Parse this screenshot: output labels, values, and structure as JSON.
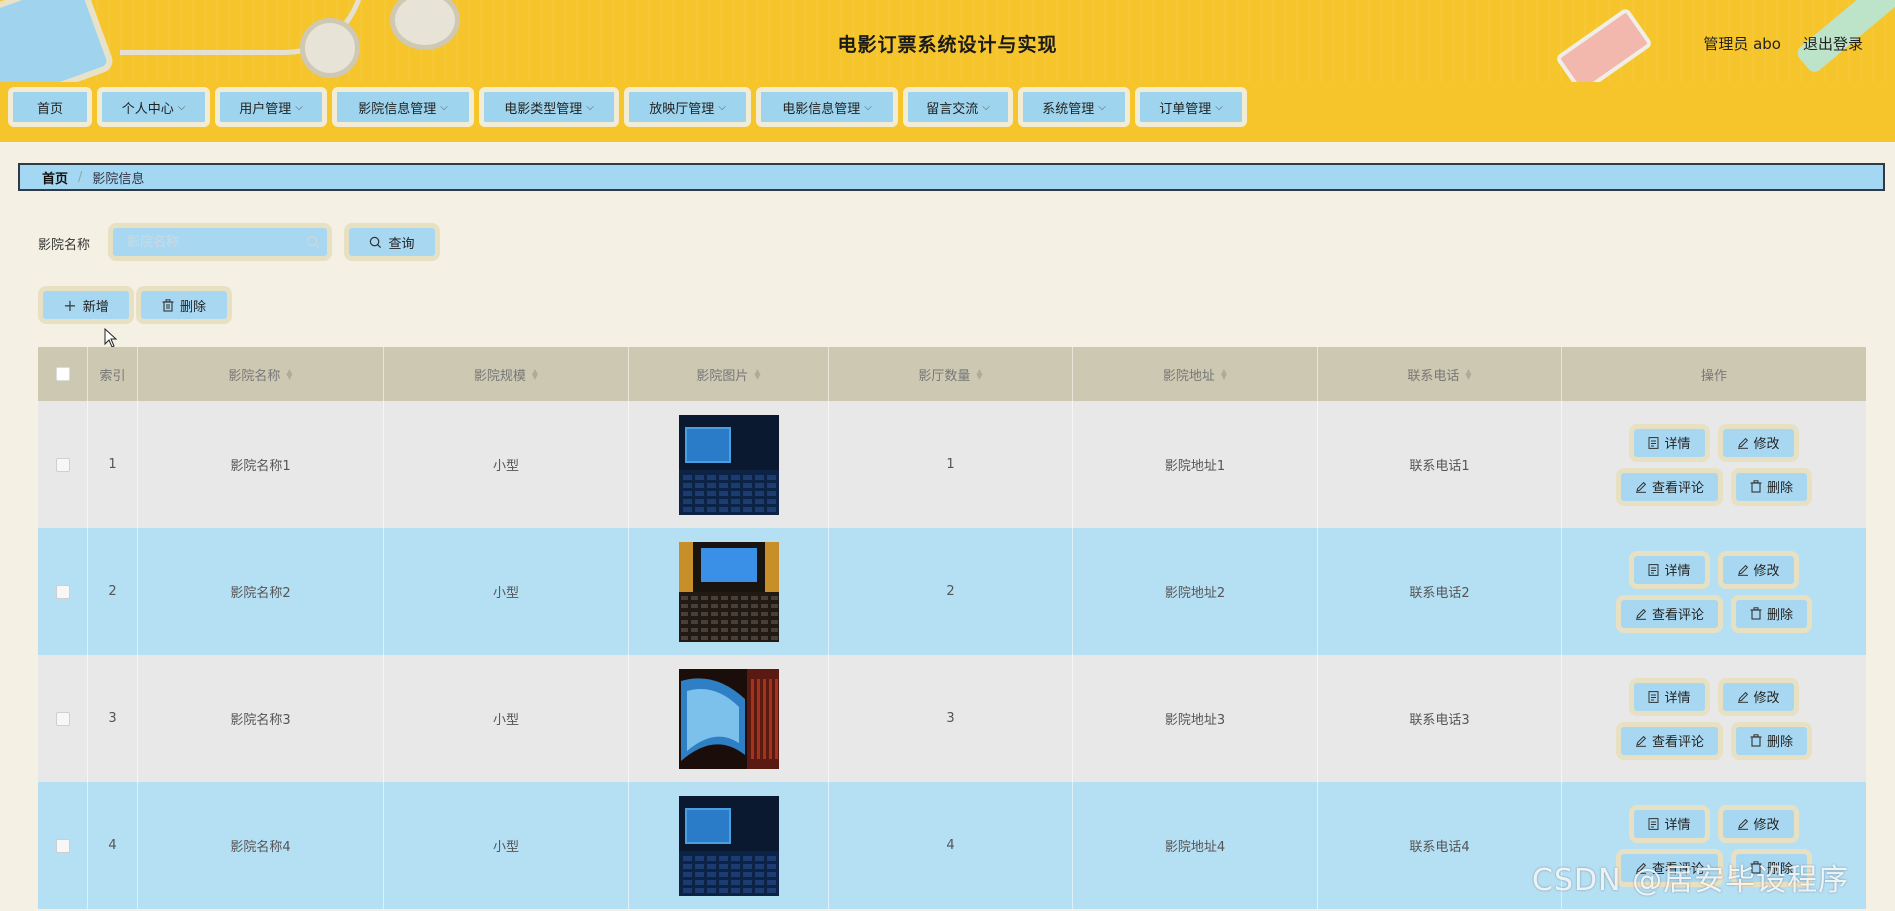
{
  "header": {
    "title": "电影订票系统设计与实现",
    "user": "管理员 abo",
    "logout": "退出登录",
    "background_color": "#f6c52c"
  },
  "nav": {
    "items": [
      {
        "label": "首页",
        "dropdown": false
      },
      {
        "label": "个人中心",
        "dropdown": true
      },
      {
        "label": "用户管理",
        "dropdown": true
      },
      {
        "label": "影院信息管理",
        "dropdown": true
      },
      {
        "label": "电影类型管理",
        "dropdown": true
      },
      {
        "label": "放映厅管理",
        "dropdown": true
      },
      {
        "label": "电影信息管理",
        "dropdown": true
      },
      {
        "label": "留言交流",
        "dropdown": true
      },
      {
        "label": "系统管理",
        "dropdown": true
      },
      {
        "label": "订单管理",
        "dropdown": true
      }
    ]
  },
  "breadcrumb": {
    "home": "首页",
    "separator": "/",
    "current": "影院信息"
  },
  "search": {
    "label": "影院名称",
    "placeholder": "影院名称",
    "value": "",
    "button": "查询"
  },
  "actions": {
    "add": "新增",
    "delete": "删除"
  },
  "table": {
    "columns": [
      "索引",
      "影院名称",
      "影院规模",
      "影院图片",
      "影厅数量",
      "影院地址",
      "联系电话",
      "操作"
    ],
    "rows": [
      {
        "index": "1",
        "name": "影院名称1",
        "scale": "小型",
        "image": "cinema-screen-dark",
        "halls": "1",
        "address": "影院地址1",
        "phone": "联系电话1"
      },
      {
        "index": "2",
        "name": "影院名称2",
        "scale": "小型",
        "image": "cinema-screen-seats",
        "halls": "2",
        "address": "影院地址2",
        "phone": "联系电话2"
      },
      {
        "index": "3",
        "name": "影院名称3",
        "scale": "小型",
        "image": "cinema-curved-screen",
        "halls": "3",
        "address": "影院地址3",
        "phone": "联系电话3"
      },
      {
        "index": "4",
        "name": "影院名称4",
        "scale": "小型",
        "image": "cinema-screen-dark",
        "halls": "4",
        "address": "影院地址4",
        "phone": "联系电话4"
      }
    ],
    "row_ops": {
      "detail": "详情",
      "edit": "修改",
      "comments": "查看评论",
      "delete": "删除"
    }
  },
  "colors": {
    "accent_blue": "#a8d8f1",
    "button_border": "#e8e0c3",
    "table_header": "#ccc8b2",
    "row_gray": "#e8e8e8",
    "row_blue": "#b5dff3",
    "page_bg": "#f4f1e4"
  },
  "watermark": "CSDN @居安毕设程序"
}
